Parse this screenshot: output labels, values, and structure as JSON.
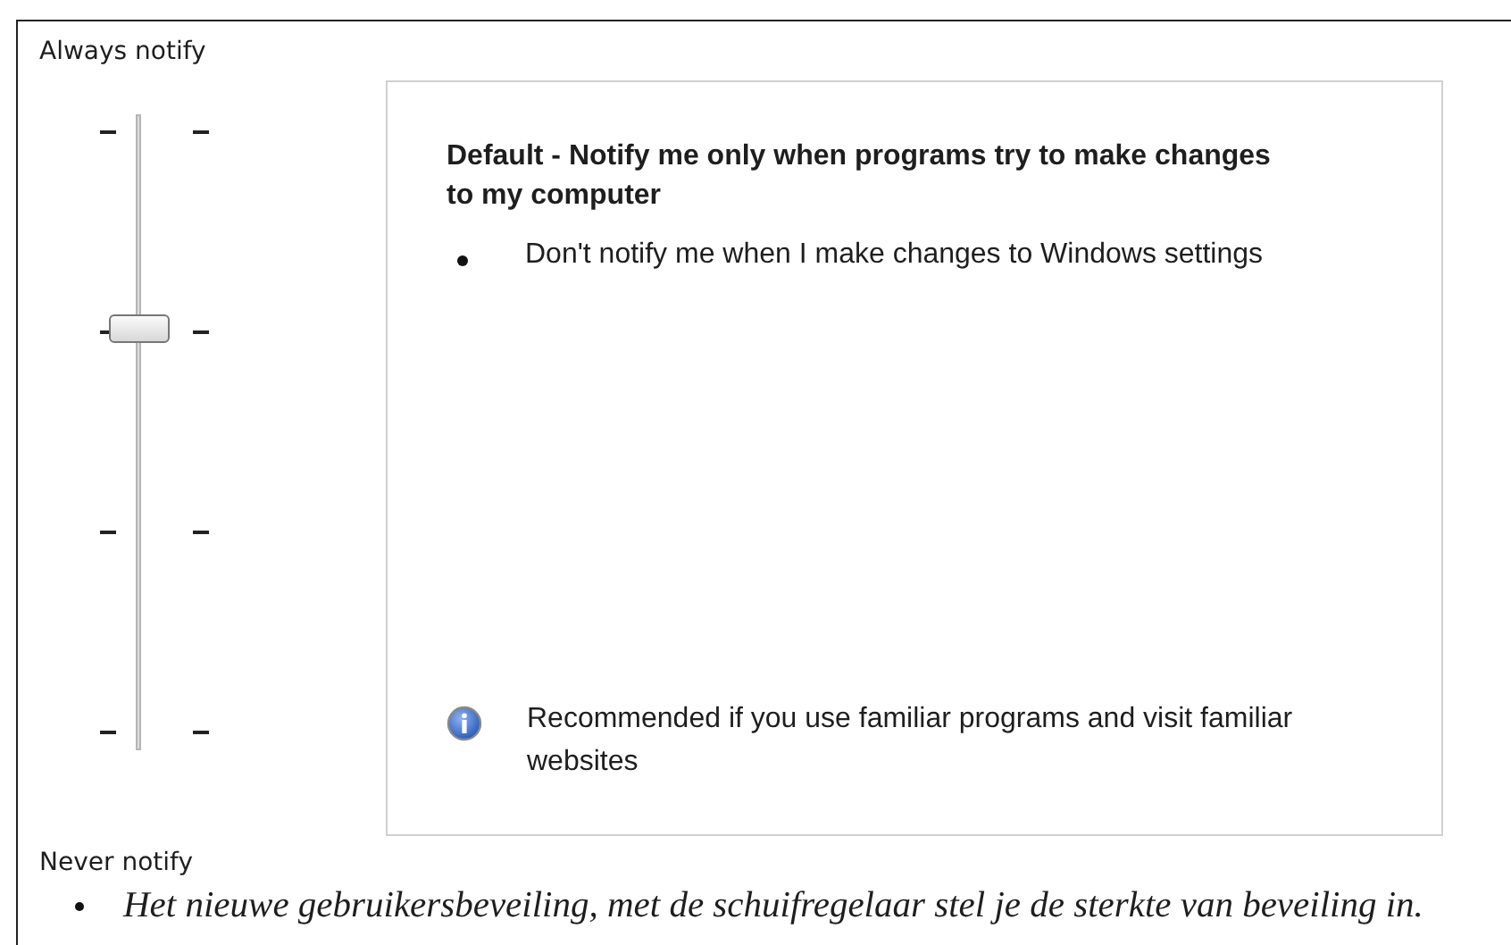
{
  "top_label": "Always notify",
  "slider": {
    "level": 0.667
  },
  "description": {
    "title": "Default - Notify me only when programs try to make changes to my computer",
    "bullets": [
      "Don't notify me when I make changes to Windows settings"
    ],
    "note": "Recommended if you use familiar programs and visit familiar websites"
  },
  "bottom_label": "Never notify",
  "captions": [
    "Het nieuwe gebruikersbeveiling, met de schuifregelaar stel je de sterkte van beveiling in."
  ]
}
